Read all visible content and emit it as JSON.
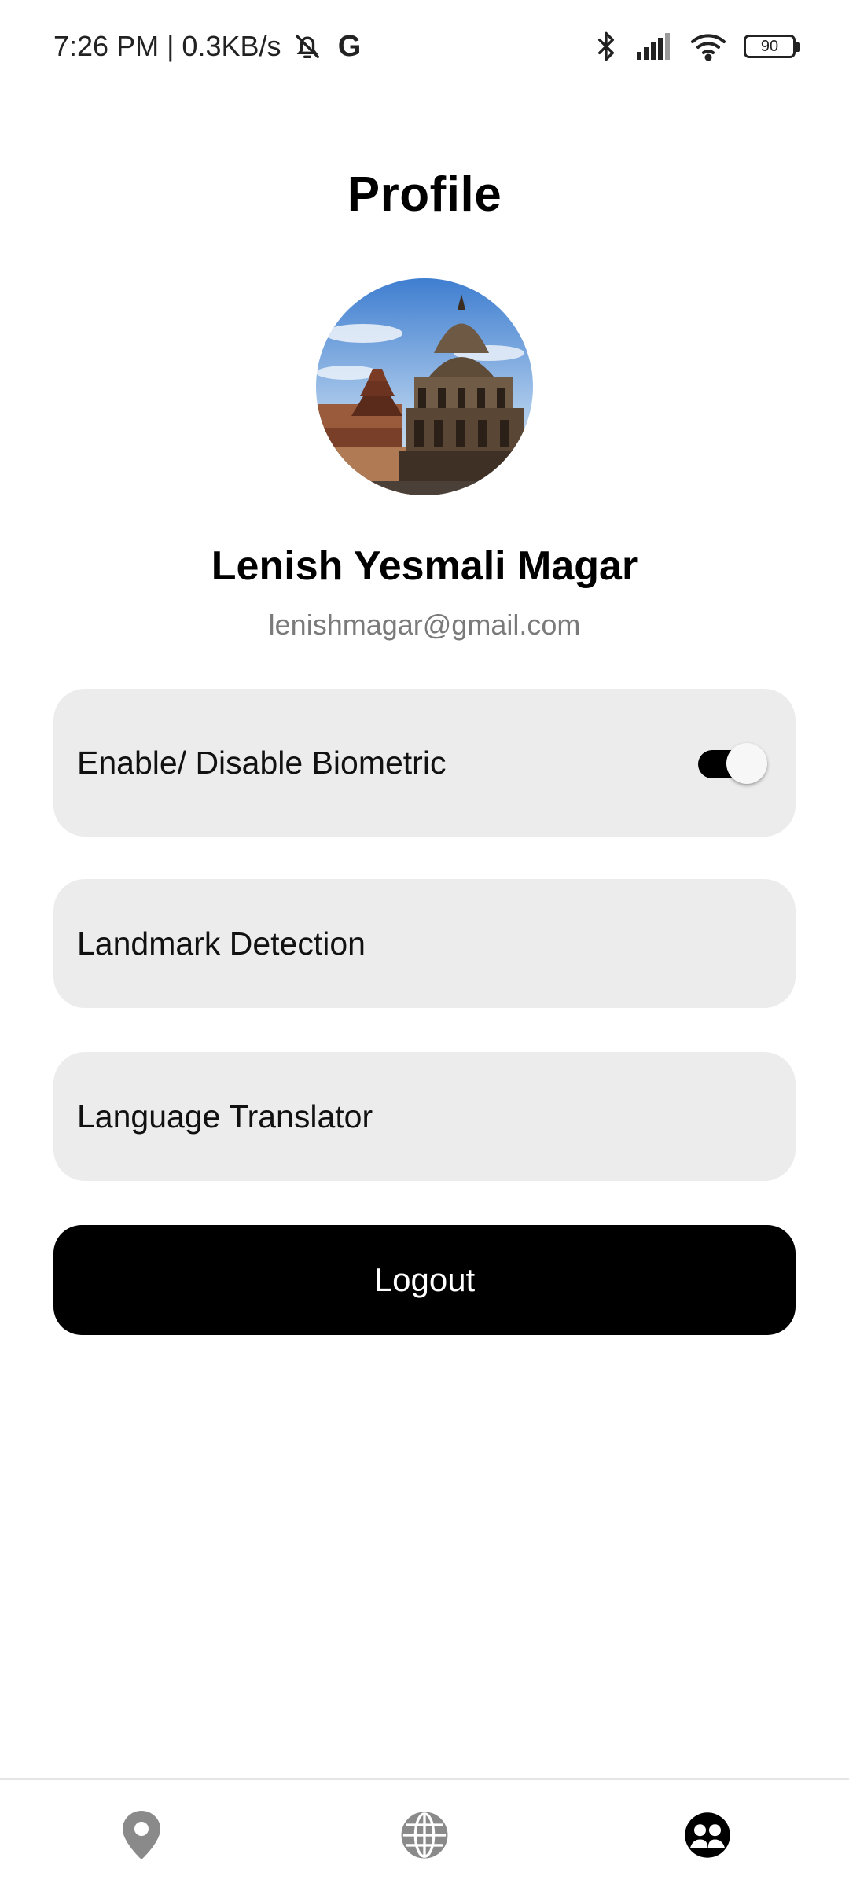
{
  "status_bar": {
    "time_speed": "7:26 PM | 0.3KB/s",
    "icons": [
      "muted-bell-icon",
      "google-icon",
      "bluetooth-icon",
      "signal-icon",
      "wifi-icon"
    ],
    "google_letter": "G",
    "battery": "90"
  },
  "page": {
    "title": "Profile"
  },
  "profile": {
    "name": "Lenish Yesmali Magar",
    "email": "lenishmagar@gmail.com"
  },
  "settings": {
    "biometric_label": "Enable/ Disable Biometric",
    "biometric_enabled": true,
    "landmark_label": "Landmark Detection",
    "translator_label": "Language Translator"
  },
  "actions": {
    "logout_label": "Logout"
  },
  "bottom_nav": {
    "items": [
      {
        "icon": "map-pin-icon",
        "active": false
      },
      {
        "icon": "globe-icon",
        "active": false
      },
      {
        "icon": "profile-icon",
        "active": true
      }
    ]
  },
  "colors": {
    "card_bg": "#ececec",
    "primary": "#000000",
    "muted_text": "#7a7a7a",
    "inactive_icon": "#8a8a8a"
  }
}
